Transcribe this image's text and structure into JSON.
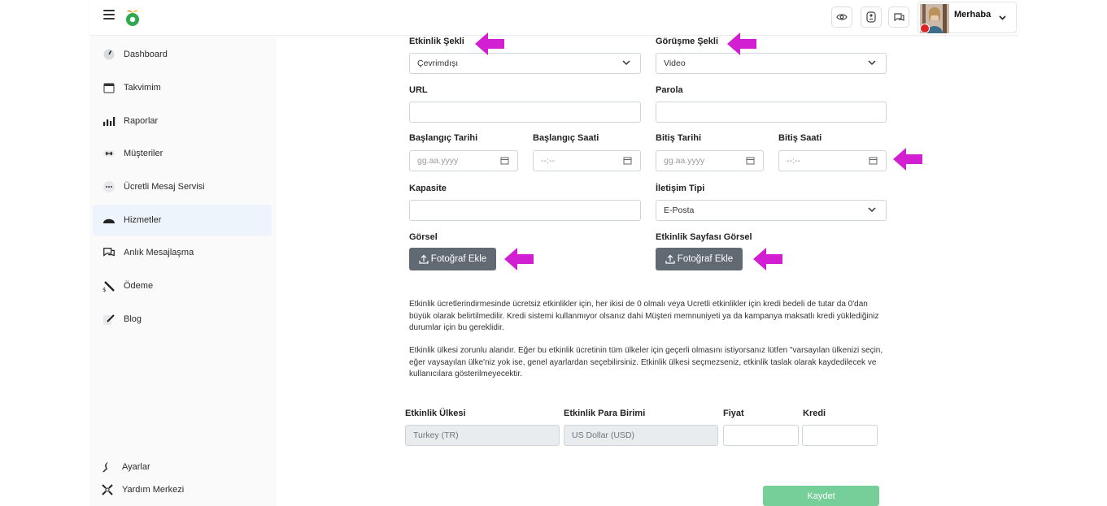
{
  "topbar": {
    "greeting": "Merhaba"
  },
  "sidebar": {
    "items": [
      {
        "label": "Dashboard"
      },
      {
        "label": "Takvimim"
      },
      {
        "label": "Raporlar"
      },
      {
        "label": "Müşteriler"
      },
      {
        "label": "Ücretli Mesaj Servisi"
      },
      {
        "label": "Hizmetler"
      },
      {
        "label": "Anlık Mesajlaşma"
      },
      {
        "label": "Ödeme"
      },
      {
        "label": "Blog"
      }
    ],
    "bottom": [
      {
        "label": "Ayarlar"
      },
      {
        "label": "Yardım Merkezi"
      }
    ]
  },
  "form": {
    "event_type_label": "Etkinlik Şekli",
    "event_type_value": "Çevrimdışı",
    "meeting_type_label": "Görüşme Şekli",
    "meeting_type_value": "Video",
    "url_label": "URL",
    "password_label": "Parola",
    "start_date_label": "Başlangıç Tarihi",
    "start_date_placeholder": "gg.aa.yyyy",
    "start_time_label": "Başlangıç Saati",
    "start_time_placeholder": "--:--",
    "end_date_label": "Bitiş Tarihi",
    "end_date_placeholder": "gg.aa.yyyy",
    "end_time_label": "Bitiş Saati",
    "end_time_placeholder": "--:--",
    "capacity_label": "Kapasite",
    "contact_type_label": "İletişim Tipi",
    "contact_type_value": "E-Posta",
    "image_label": "Görsel",
    "page_image_label": "Etkinlik Sayfası Görsel",
    "upload_label": "Fotoğraf Ekle",
    "info_1": "Etkinlik ücretlerindirmesinde ücretsiz etkinlikler için, her ikisi de 0 olmalı veya Ucretli etkinlikler için kredi bedeli de tutar da 0'dan büyük olarak belirtilmedilir. Kredi sistemi kullanmıyor olsanız dahi Müşteri memnuniyeti ya da kampanya maksatlı kredi yüklediğiniz durumlar için bu gereklidir.",
    "info_2": "Etkinlik ülkesi zorunlu alandır. Eğer bu etkinlik ücretinin tüm ülkeler için geçerli olmasını istiyorsanız lütfen \"varsayılan ülkenizi seçin, eğer vaysayılan ülke'niz yok ise, genel ayarlardan seçebilirsiniz. Etkinlik ülkesi seçmezseniz, etkinlik taslak olarak kaydedilecek ve kullanıcılara gösterilmeyecektir.",
    "country_label": "Etkinlik Ülkesi",
    "country_value": "Turkey (TR)",
    "currency_label": "Etkinlik Para Birimi",
    "currency_value": "US Dollar (USD)",
    "price_label": "Fiyat",
    "credit_label": "Kredi",
    "save_label": "Kaydet"
  },
  "colors": {
    "arrow": "#d21fd2",
    "save": "#76cf98",
    "upload": "#616a73",
    "active_nav": "#eef4fb"
  }
}
